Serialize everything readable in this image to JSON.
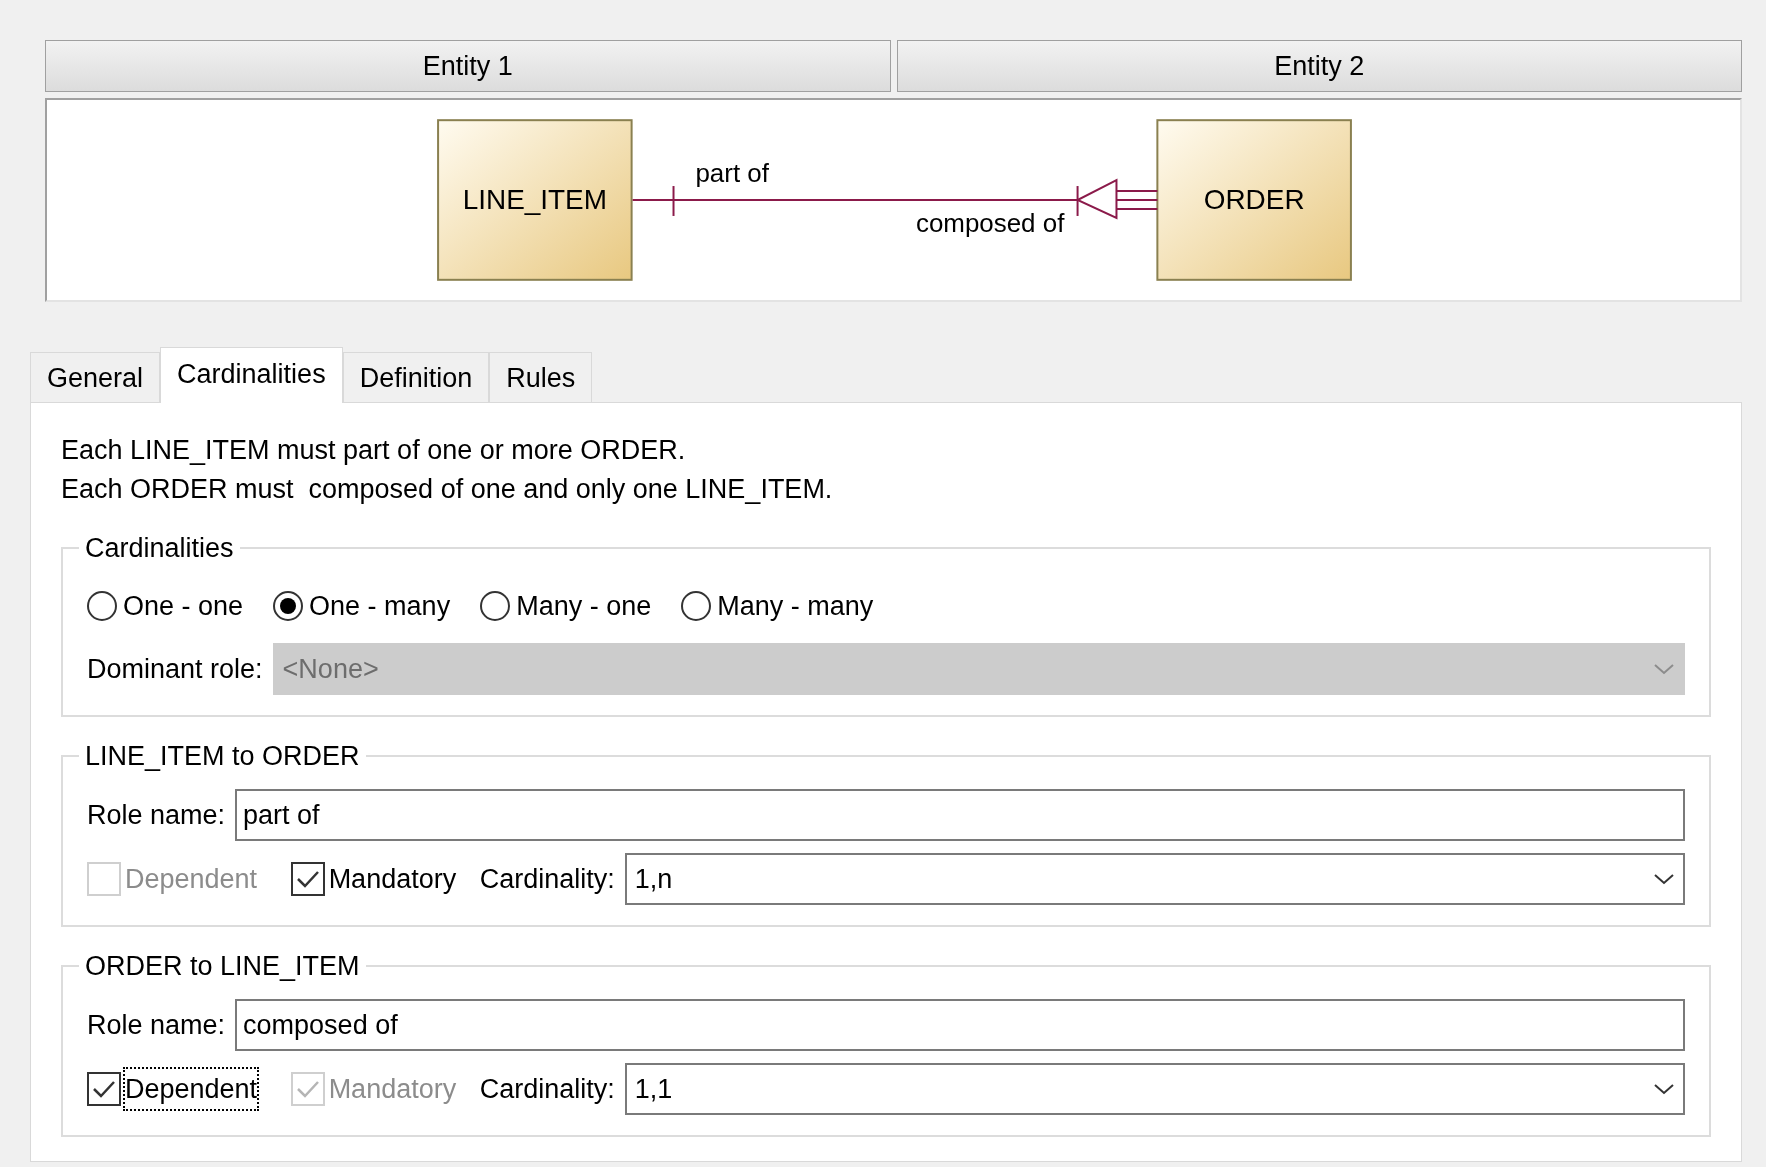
{
  "columns": [
    "Entity 1",
    "Entity 2"
  ],
  "diagram": {
    "entity_1": "LINE_ITEM",
    "entity_2": "ORDER",
    "role_1": "part of",
    "role_2": "composed of"
  },
  "tabs": [
    {
      "label": "General",
      "selected": false
    },
    {
      "label": "Cardinalities",
      "selected": true
    },
    {
      "label": "Definition",
      "selected": false
    },
    {
      "label": "Rules",
      "selected": false
    }
  ],
  "sentences": [
    "Each LINE_ITEM must part of one or more ORDER.",
    "Each ORDER must  composed of one and only one LINE_ITEM."
  ],
  "cardinalities": {
    "title": "Cardinalities",
    "options": [
      {
        "label": "One - one",
        "selected": false
      },
      {
        "label": "One - many",
        "selected": true
      },
      {
        "label": "Many - one",
        "selected": false
      },
      {
        "label": "Many - many",
        "selected": false
      }
    ],
    "dominant_role": {
      "label": "Dominant role:",
      "value": "<None>",
      "disabled": true
    }
  },
  "roles": [
    {
      "title": "LINE_ITEM to ORDER",
      "role_label": "Role name:",
      "role_name": "part of",
      "dependent": {
        "label": "Dependent",
        "checked": false,
        "disabled": true,
        "focused": false
      },
      "mandatory": {
        "label": "Mandatory",
        "checked": true,
        "disabled": false,
        "focused": false
      },
      "cardinality_label": "Cardinality:",
      "cardinality": "1,n"
    },
    {
      "title": "ORDER to LINE_ITEM",
      "role_label": "Role name:",
      "role_name": "composed of",
      "dependent": {
        "label": "Dependent",
        "checked": true,
        "disabled": false,
        "focused": true
      },
      "mandatory": {
        "label": "Mandatory",
        "checked": true,
        "disabled": true,
        "focused": false
      },
      "cardinality_label": "Cardinality:",
      "cardinality": "1,1"
    }
  ]
}
